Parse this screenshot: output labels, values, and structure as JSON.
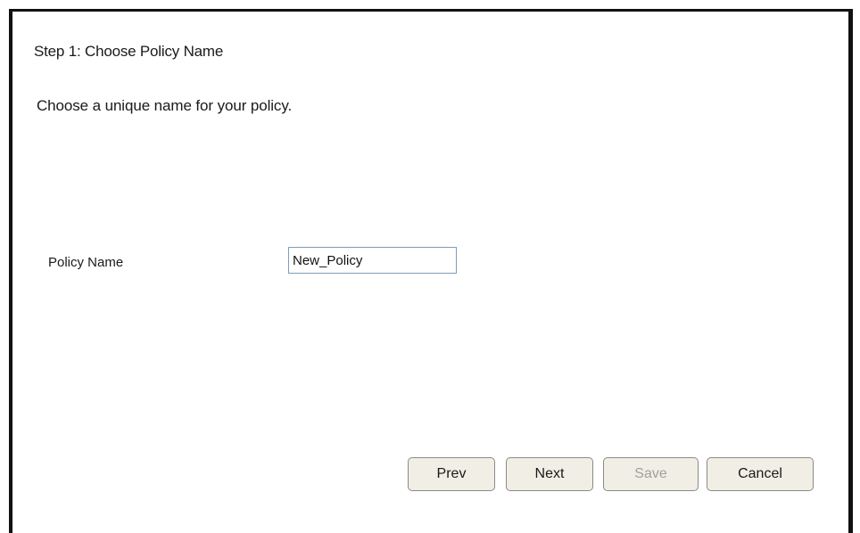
{
  "wizard": {
    "step_title": "Step 1: Choose Policy Name",
    "instructions": "Choose a unique name for your policy."
  },
  "form": {
    "policy_name_label": "Policy Name",
    "policy_name_value": "New_Policy"
  },
  "buttons": {
    "prev_label": "Prev",
    "next_label": "Next",
    "save_label": "Save",
    "save_disabled": true,
    "cancel_label": "Cancel"
  }
}
